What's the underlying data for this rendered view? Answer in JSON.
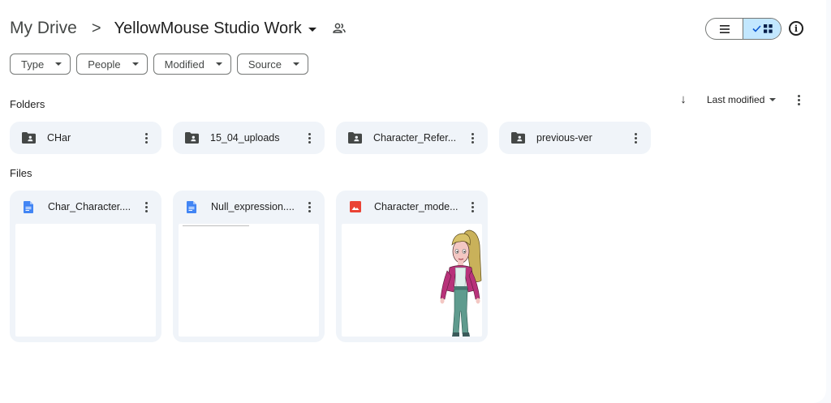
{
  "breadcrumb": {
    "root": "My Drive",
    "separator": ">",
    "current": "YellowMouse Studio Work"
  },
  "filters": [
    "Type",
    "People",
    "Modified",
    "Source"
  ],
  "sections": {
    "folders": "Folders",
    "files": "Files"
  },
  "sort": {
    "label": "Last modified",
    "direction": "descending"
  },
  "view": {
    "mode": "grid"
  },
  "folders": [
    {
      "name": "CHar",
      "icon": "shared-folder-icon"
    },
    {
      "name": "15_04_uploads",
      "icon": "shared-folder-icon"
    },
    {
      "name": "Character_Refer...",
      "icon": "shared-folder-icon"
    },
    {
      "name": "previous-ver",
      "icon": "shared-folder-icon"
    }
  ],
  "files": [
    {
      "name": "Char_Character....",
      "icon": "google-doc-icon",
      "icon_color": "#4285f4",
      "preview": "blank-document"
    },
    {
      "name": "Null_expression....",
      "icon": "google-doc-icon",
      "icon_color": "#4285f4",
      "preview": "document"
    },
    {
      "name": "Character_mode...",
      "icon": "image-file-icon",
      "icon_color": "#ea4335",
      "preview": "character-image"
    }
  ],
  "colors": {
    "selected_toggle": "#c2e7ff",
    "card_bg": "#f0f4f9",
    "accent": "#0b57d0"
  }
}
